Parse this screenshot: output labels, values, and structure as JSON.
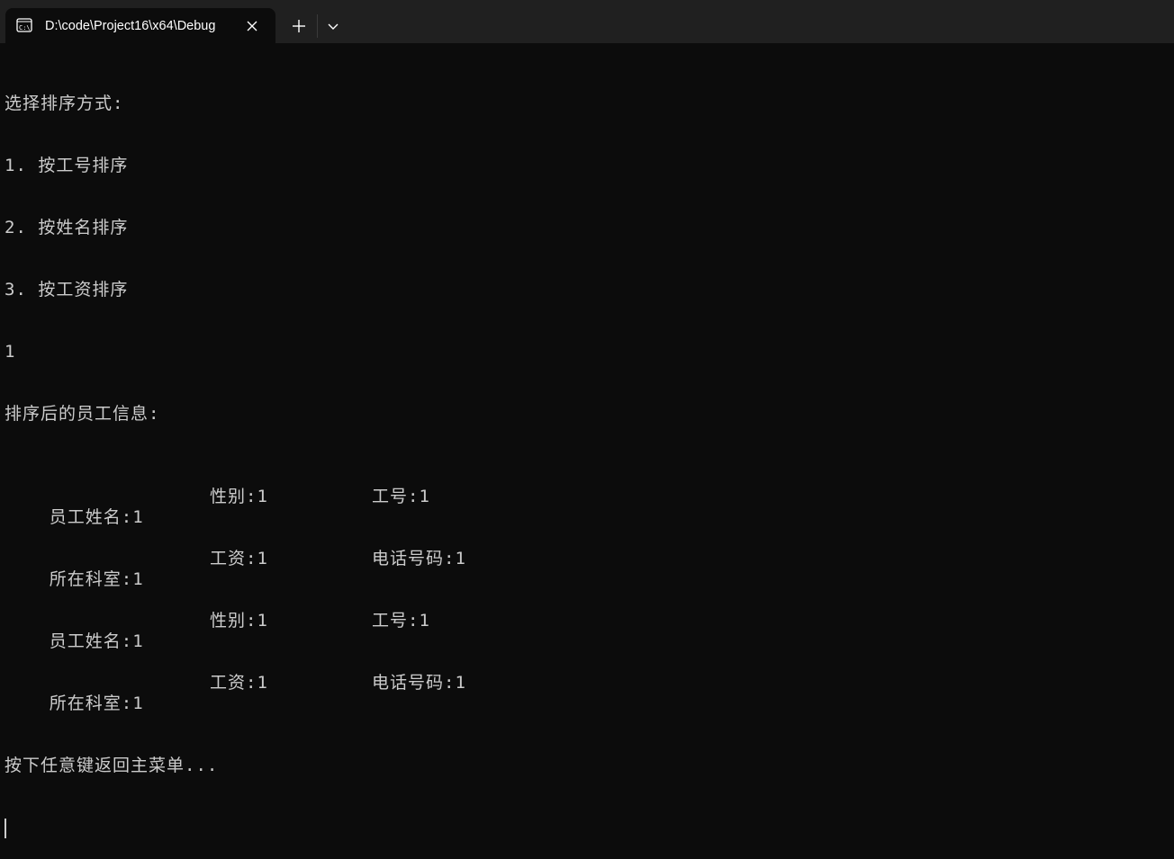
{
  "window": {
    "tab_title": "D:\\code\\Project16\\x64\\Debug",
    "tab_icon": "terminal-icon",
    "close_icon": "close-icon",
    "new_tab_icon": "plus-icon",
    "dropdown_icon": "chevron-down-icon"
  },
  "console": {
    "lines": [
      "选择排序方式:",
      "1. 按工号排序",
      "2. 按姓名排序",
      "3. 按工资排序",
      "1",
      "排序后的员工信息:"
    ],
    "records": [
      {
        "name": "员工姓名:1",
        "gender": "性别:1",
        "id": "工号:1",
        "dept": "所在科室:1",
        "salary": "工资:1",
        "phone": "电话号码:1"
      },
      {
        "name": "员工姓名:1",
        "gender": "性别:1",
        "id": "工号:1",
        "dept": "所在科室:1",
        "salary": "工资:1",
        "phone": "电话号码:1"
      }
    ],
    "footer": "按下任意键返回主菜单..."
  },
  "colors": {
    "background": "#0c0c0c",
    "titlebar": "#202020",
    "text": "#cccccc"
  }
}
